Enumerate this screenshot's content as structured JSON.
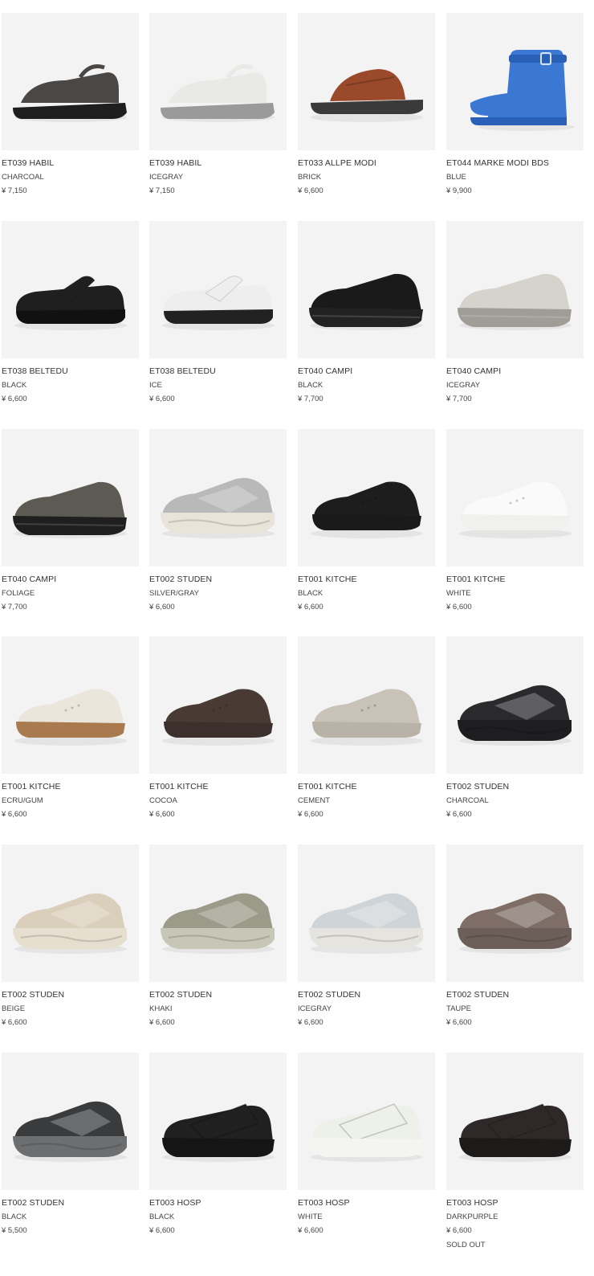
{
  "products": [
    {
      "name": "ET039 HABIL",
      "color": "CHARCOAL",
      "price": "¥ 7,150",
      "shoe": "sandal",
      "fill": "#4a4745",
      "sole": "#1e1e1e"
    },
    {
      "name": "ET039 HABIL",
      "color": "ICEGRAY",
      "price": "¥ 7,150",
      "shoe": "sandal",
      "fill": "#e9e9e6",
      "sole": "#9a9a9a"
    },
    {
      "name": "ET033 ALLPE MODI",
      "color": "BRICK",
      "price": "¥ 6,600",
      "shoe": "slide",
      "fill": "#9a4a2a",
      "sole": "#3a3a3a"
    },
    {
      "name": "ET044 MARKE MODI BDS",
      "color": "BLUE",
      "price": "¥ 9,900",
      "shoe": "boot",
      "fill": "#3b78d4",
      "sole": "#2a60b8"
    },
    {
      "name": "ET038 BELTEDU",
      "color": "BLACK",
      "price": "¥ 6,600",
      "shoe": "strap",
      "fill": "#1f1f1f",
      "sole": "#111111"
    },
    {
      "name": "ET038 BELTEDU",
      "color": "ICE",
      "price": "¥ 6,600",
      "shoe": "strap",
      "fill": "#eeeeef",
      "sole": "#222222"
    },
    {
      "name": "ET040 CAMPI",
      "color": "BLACK",
      "price": "¥ 7,700",
      "shoe": "slipon",
      "fill": "#1a1a1a",
      "sole": "#222222"
    },
    {
      "name": "ET040 CAMPI",
      "color": "ICEGRAY",
      "price": "¥ 7,700",
      "shoe": "slipon",
      "fill": "#d6d2cc",
      "sole": "#a09c96"
    },
    {
      "name": "ET040 CAMPI",
      "color": "FOLIAGE",
      "price": "¥ 7,700",
      "shoe": "slipon",
      "fill": "#5c5a52",
      "sole": "#1f1f1f"
    },
    {
      "name": "ET002 STUDEN",
      "color": "SILVER/GRAY",
      "price": "¥ 6,600",
      "shoe": "runner",
      "fill": "#b9b9b9",
      "sole": "#e8e4da"
    },
    {
      "name": "ET001 KITCHE",
      "color": "BLACK",
      "price": "¥ 6,600",
      "shoe": "court",
      "fill": "#1d1d1d",
      "sole": "#1a1a1a"
    },
    {
      "name": "ET001 KITCHE",
      "color": "WHITE",
      "price": "¥ 6,600",
      "shoe": "court",
      "fill": "#fafafa",
      "sole": "#f0f0ec"
    },
    {
      "name": "ET001 KITCHE",
      "color": "ECRU/GUM",
      "price": "¥ 6,600",
      "shoe": "court",
      "fill": "#ebe6dc",
      "sole": "#a87a4e"
    },
    {
      "name": "ET001 KITCHE",
      "color": "COCOA",
      "price": "¥ 6,600",
      "shoe": "court",
      "fill": "#4a3a34",
      "sole": "#3b302c"
    },
    {
      "name": "ET001 KITCHE",
      "color": "CEMENT",
      "price": "¥ 6,600",
      "shoe": "court",
      "fill": "#c9c2b6",
      "sole": "#b9b2a6"
    },
    {
      "name": "ET002 STUDEN",
      "color": "CHARCOAL",
      "price": "¥ 6,600",
      "shoe": "runner",
      "fill": "#2a2a2c",
      "sole": "#1e1e20"
    },
    {
      "name": "ET002 STUDEN",
      "color": "BEIGE",
      "price": "¥ 6,600",
      "shoe": "runner",
      "fill": "#d9cfbb",
      "sole": "#e6dfcf"
    },
    {
      "name": "ET002 STUDEN",
      "color": "KHAKI",
      "price": "¥ 6,600",
      "shoe": "runner",
      "fill": "#9c9a88",
      "sole": "#c8c6b6"
    },
    {
      "name": "ET002 STUDEN",
      "color": "ICEGRAY",
      "price": "¥ 6,600",
      "shoe": "runner",
      "fill": "#cfd4d8",
      "sole": "#e6e4de"
    },
    {
      "name": "ET002 STUDEN",
      "color": "TAUPE",
      "price": "¥ 6,600",
      "shoe": "runner",
      "fill": "#7e6e66",
      "sole": "#6c5e58"
    },
    {
      "name": "ET002 STUDEN",
      "color": "BLACK",
      "price": "¥ 5,500",
      "shoe": "runner",
      "fill": "#3a3b3d",
      "sole": "#6d6e70"
    },
    {
      "name": "ET003 HOSP",
      "color": "BLACK",
      "price": "¥ 6,600",
      "shoe": "velcro",
      "fill": "#202020",
      "sole": "#151515"
    },
    {
      "name": "ET003 HOSP",
      "color": "WHITE",
      "price": "¥ 6,600",
      "shoe": "velcro",
      "fill": "#eef0ea",
      "sole": "#f4f4f0"
    },
    {
      "name": "ET003 HOSP",
      "color": "DARKPURPLE",
      "price": "¥ 6,600",
      "shoe": "velcro",
      "fill": "#2e2928",
      "sole": "#1d1a1a",
      "status": "SOLD OUT"
    }
  ]
}
